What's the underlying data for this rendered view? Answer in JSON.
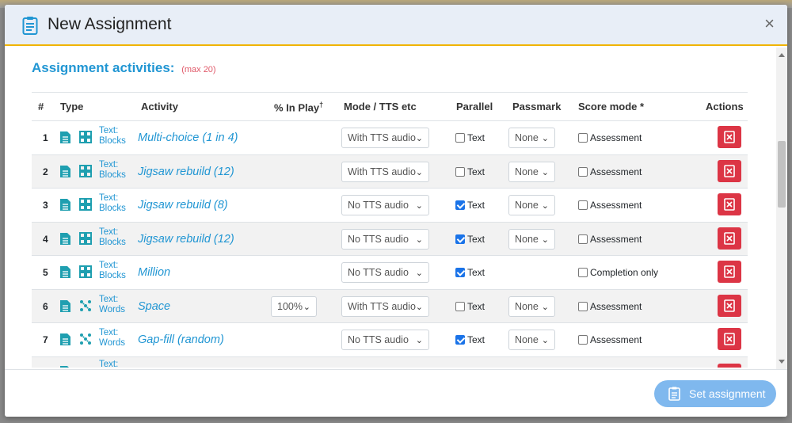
{
  "header": {
    "title": "New Assignment",
    "close_label": "×"
  },
  "section": {
    "title": "Assignment activities:",
    "max": "(max 20)"
  },
  "columns": [
    "#",
    "Type",
    "Activity",
    "% In Play",
    "Mode / TTS etc",
    "Parallel",
    "Passmark",
    "Score mode *",
    "Actions"
  ],
  "inplay_marker": "†",
  "rows": [
    {
      "num": "1",
      "type_line1": "Text:",
      "type_line2": "Blocks",
      "type_icon": "blocks-icon",
      "activity": "Multi-choice (1 in 4)",
      "inplay": "",
      "mode": "With TTS audio",
      "parallel_checked": false,
      "parallel_label": "Text",
      "passmark": "None",
      "score_label": "Assessment"
    },
    {
      "num": "2",
      "type_line1": "Text:",
      "type_line2": "Blocks",
      "type_icon": "blocks-icon",
      "activity": "Jigsaw rebuild (12)",
      "inplay": "",
      "mode": "With TTS audio",
      "parallel_checked": false,
      "parallel_label": "Text",
      "passmark": "None",
      "score_label": "Assessment"
    },
    {
      "num": "3",
      "type_line1": "Text:",
      "type_line2": "Blocks",
      "type_icon": "blocks-icon",
      "activity": "Jigsaw rebuild (8)",
      "inplay": "",
      "mode": "No TTS audio",
      "parallel_checked": true,
      "parallel_label": "Text",
      "passmark": "None",
      "score_label": "Assessment"
    },
    {
      "num": "4",
      "type_line1": "Text:",
      "type_line2": "Blocks",
      "type_icon": "blocks-icon",
      "activity": "Jigsaw rebuild (12)",
      "inplay": "",
      "mode": "No TTS audio",
      "parallel_checked": true,
      "parallel_label": "Text",
      "passmark": "None",
      "score_label": "Assessment"
    },
    {
      "num": "5",
      "type_line1": "Text:",
      "type_line2": "Blocks",
      "type_icon": "blocks-icon",
      "activity": "Million",
      "inplay": "",
      "mode": "No TTS audio",
      "parallel_checked": true,
      "parallel_label": "Text",
      "passmark": "",
      "score_label": "Completion only"
    },
    {
      "num": "6",
      "type_line1": "Text:",
      "type_line2": "Words",
      "type_icon": "words-icon",
      "activity": "Space",
      "inplay": "100%",
      "mode": "With TTS audio",
      "parallel_checked": false,
      "parallel_label": "Text",
      "passmark": "None",
      "score_label": "Assessment"
    },
    {
      "num": "7",
      "type_line1": "Text:",
      "type_line2": "Words",
      "type_icon": "words-icon",
      "activity": "Gap-fill (random)",
      "inplay": "",
      "mode": "No TTS audio",
      "parallel_checked": true,
      "parallel_label": "Text",
      "passmark": "None",
      "score_label": "Assessment"
    }
  ],
  "partial_row": {
    "type_line1": "Text:"
  },
  "footer": {
    "set_label": "Set assignment"
  },
  "colors": {
    "accent": "#2196d3",
    "danger": "#dc3545",
    "header_bg": "#e8eef7",
    "header_border": "#f0b400"
  }
}
